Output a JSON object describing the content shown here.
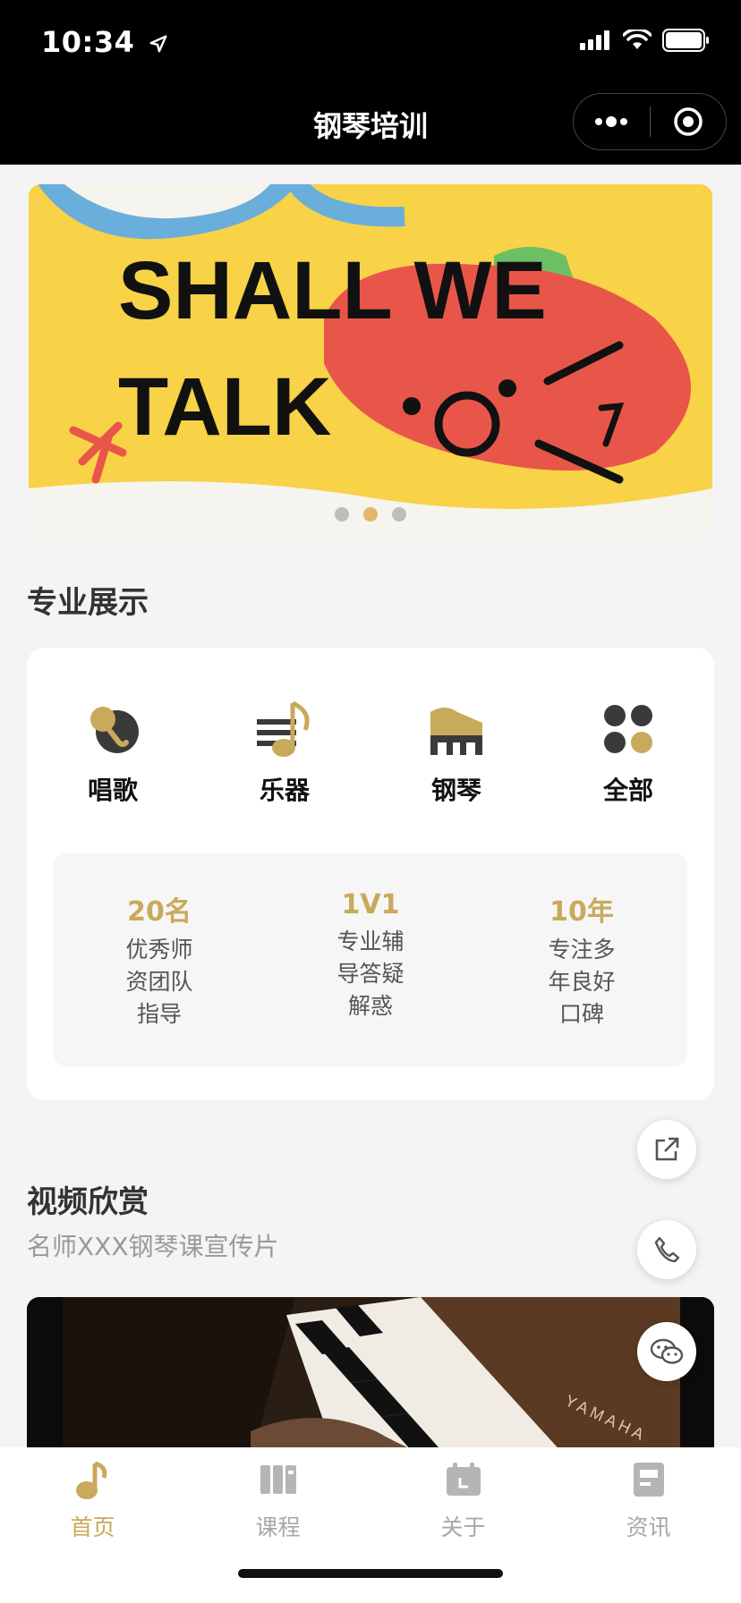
{
  "status": {
    "time": "10:34"
  },
  "nav": {
    "title": "钢琴培训"
  },
  "banner": {
    "text_line1": "SHALL WE",
    "text_line2": "TALK",
    "active_index": 1,
    "dot_count": 3
  },
  "sections": {
    "showcase_title": "专业展示",
    "video_title": "视频欣赏",
    "video_subtitle": "名师XXX钢琴课宣传片"
  },
  "categories": [
    {
      "label": "唱歌",
      "icon": "microphone-icon"
    },
    {
      "label": "乐器",
      "icon": "music-note-icon"
    },
    {
      "label": "钢琴",
      "icon": "piano-icon"
    },
    {
      "label": "全部",
      "icon": "grid-icon"
    }
  ],
  "stats": [
    {
      "value": "20名",
      "lines": [
        "优秀师",
        "资团队",
        "指导"
      ]
    },
    {
      "value": "1V1",
      "lines": [
        "专业辅",
        "导答疑",
        "解惑"
      ]
    },
    {
      "value": "10年",
      "lines": [
        "专注多",
        "年良好",
        "口碑"
      ]
    }
  ],
  "video": {
    "brand_text": "YAMAHA"
  },
  "floating_buttons": [
    "share-icon",
    "phone-icon",
    "wechat-icon"
  ],
  "tabs": [
    {
      "label": "首页",
      "icon": "music-note-icon",
      "active": true
    },
    {
      "label": "课程",
      "icon": "books-icon",
      "active": false
    },
    {
      "label": "关于",
      "icon": "calendar-icon",
      "active": false
    },
    {
      "label": "资讯",
      "icon": "document-icon",
      "active": false
    }
  ],
  "colors": {
    "accent": "#c9a95b",
    "dark": "#3a3a3a",
    "banner_yellow": "#f8d247",
    "banner_red": "#e8564a",
    "banner_blue": "#6aaedc",
    "banner_green": "#6cbf63"
  }
}
